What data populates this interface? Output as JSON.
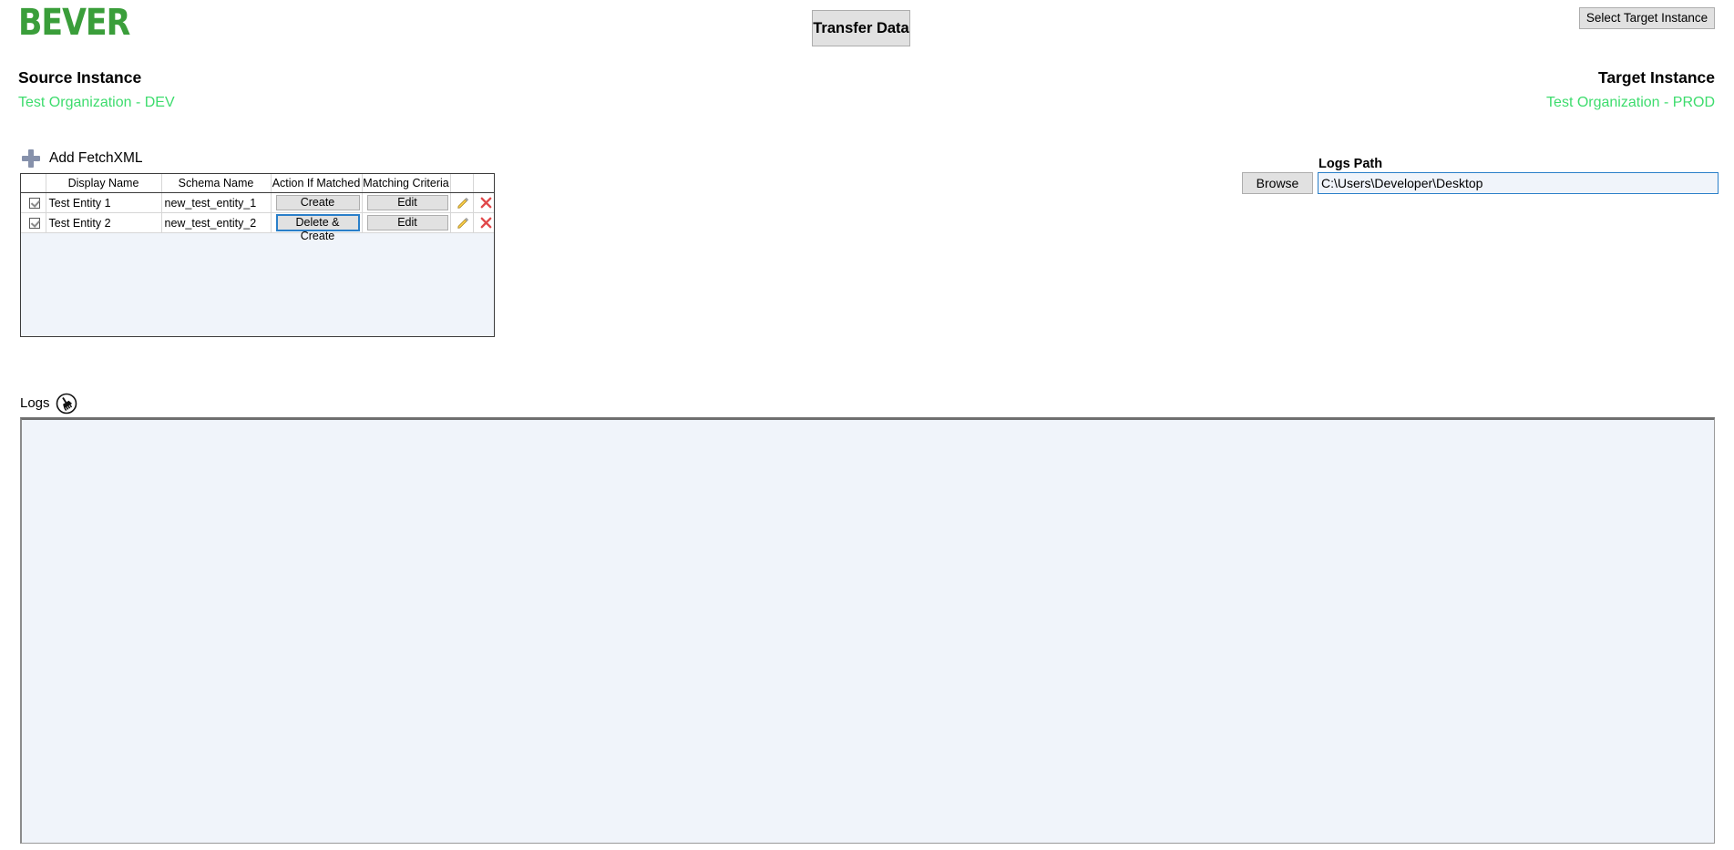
{
  "app": {
    "logo_text": "BEVER",
    "logo_color": "#3a9e3a"
  },
  "toolbar": {
    "transfer_data_label": "Transfer Data",
    "select_target_instance_label": "Select Target Instance"
  },
  "instances": {
    "source_title": "Source Instance",
    "source_value": "Test Organization - DEV",
    "target_title": "Target Instance",
    "target_value": "Test Organization - PROD",
    "value_color": "#3ddc6d"
  },
  "fetchxml": {
    "add_label": "Add FetchXML",
    "add_icon": "plus-icon"
  },
  "grid": {
    "columns": [
      "",
      "Display Name",
      "Schema Name",
      "Action If Matched",
      "Matching Criteria",
      "",
      ""
    ],
    "rows": [
      {
        "checked": true,
        "display_name": "Test Entity 1",
        "schema_name": "new_test_entity_1",
        "action_if_matched": "Create",
        "action_focused": false,
        "matching_criteria": "Edit",
        "edit_icon": "pencil-icon",
        "delete_icon": "x-icon"
      },
      {
        "checked": true,
        "display_name": "Test Entity 2",
        "schema_name": "new_test_entity_2",
        "action_if_matched": "Delete & Create",
        "action_focused": true,
        "matching_criteria": "Edit",
        "edit_icon": "pencil-icon",
        "delete_icon": "x-icon"
      }
    ]
  },
  "logs_path": {
    "label": "Logs Path",
    "browse_label": "Browse",
    "value": "C:\\Users\\Developer\\Desktop",
    "placeholder": ""
  },
  "logs": {
    "label": "Logs",
    "clear_icon": "broom-icon",
    "content": ""
  }
}
